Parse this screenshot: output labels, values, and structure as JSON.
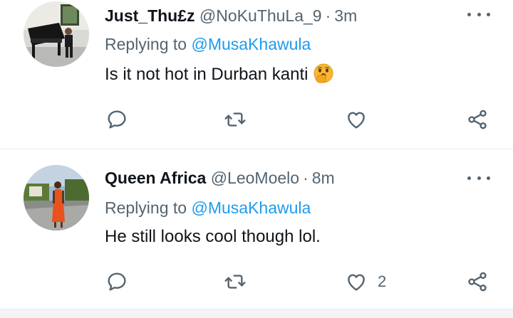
{
  "tweets": [
    {
      "name": "Just_Thu£z",
      "handle": "@NoKuThuLa_9",
      "separator": "·",
      "time": "3m",
      "replying_prefix": "Replying to",
      "replying_to": "@MusaKhawula",
      "text": "Is it not hot in Durban kanti",
      "emoji": "face-with-hand-over-mouth-emoji",
      "like_count": "",
      "avatar": "avatar-person-at-piano"
    },
    {
      "name": "Queen Africa",
      "handle": "@LeoMoelo",
      "separator": "·",
      "time": "8m",
      "replying_prefix": "Replying to",
      "replying_to": "@MusaKhawula",
      "text": "He still looks cool though lol.",
      "emoji": "",
      "like_count": "2",
      "avatar": "avatar-woman-in-orange-dress"
    }
  ],
  "icons": {
    "more": "more-dots-icon",
    "reply": "reply-icon",
    "retweet": "retweet-icon",
    "like": "heart-icon",
    "share": "share-icon"
  },
  "colors": {
    "text": "#0f1419",
    "secondary": "#536471",
    "mention": "#1d9bf0",
    "divider": "#e6eaed"
  }
}
